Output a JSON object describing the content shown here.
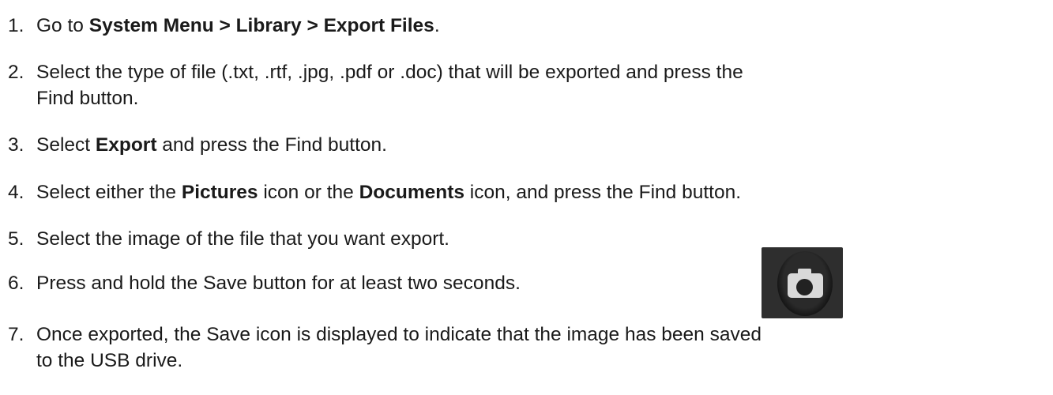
{
  "steps": [
    {
      "number": "1.",
      "parts": {
        "a": "Go to ",
        "b_bold": "System Menu > Library > Export Files",
        "c": "."
      }
    },
    {
      "number": "2.",
      "line1": "Select the type of file (.txt, .rtf, .jpg, .pdf or .doc) that will be exported and press the",
      "line2": "Find button."
    },
    {
      "number": "3.",
      "parts": {
        "a": "Select ",
        "b_bold": "Export",
        "c": " and press the Find button."
      }
    },
    {
      "number": "4.",
      "parts": {
        "a": "Select either the ",
        "b_bold": "Pictures",
        "c": " icon or the ",
        "d_bold": "Documents",
        "e": " icon, and press the Find button."
      }
    },
    {
      "number": "5.",
      "text": "Select the image of the file that you want export."
    },
    {
      "number": "6.",
      "text": "Press and hold the Save button for at least two seconds."
    },
    {
      "number": "7.",
      "line1": "Once exported, the Save icon is displayed to indicate that the image has been saved",
      "line2": "to the USB drive."
    }
  ],
  "icons": {
    "save_button": "camera-icon"
  }
}
